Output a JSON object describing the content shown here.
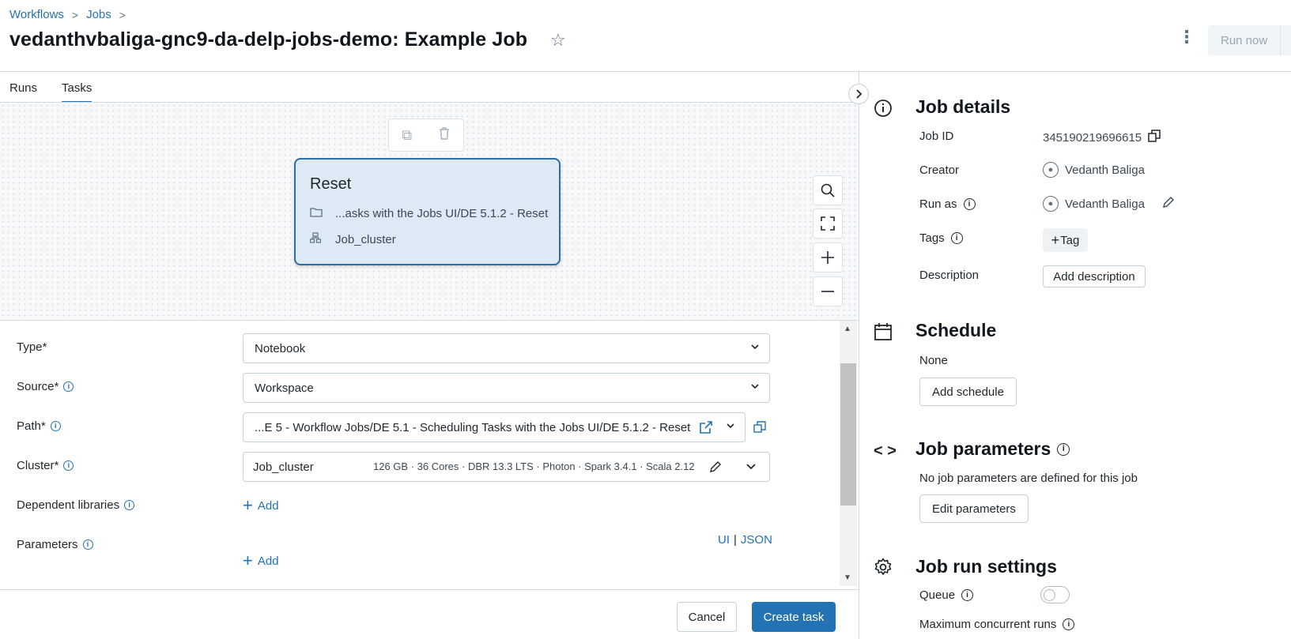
{
  "breadcrumb": {
    "items": [
      "Workflows",
      "Jobs"
    ],
    "separator": ">"
  },
  "title": "vedanthvbaliga-gnc9-da-delp-jobs-demo: Example Job",
  "header": {
    "run_now": "Run now",
    "kebab": "⋮",
    "star": "☆"
  },
  "tabs": [
    {
      "label": "Runs",
      "active": false
    },
    {
      "label": "Tasks",
      "active": true
    }
  ],
  "task_node": {
    "name": "Reset",
    "path": "...asks with the Jobs UI/DE 5.1.2 - Reset",
    "cluster": "Job_cluster"
  },
  "form": {
    "type": {
      "label": "Type*",
      "value": "Notebook"
    },
    "source": {
      "label": "Source*",
      "value": "Workspace"
    },
    "path": {
      "label": "Path*",
      "value": "...E 5 - Workflow Jobs/DE 5.1 - Scheduling Tasks with the Jobs UI/DE 5.1.2 - Reset"
    },
    "cluster": {
      "label": "Cluster*",
      "name": "Job_cluster",
      "details": "126 GB · 36 Cores · DBR 13.3 LTS · Photon · Spark 3.4.1 · Scala 2.12"
    },
    "dependent_libraries": {
      "label": "Dependent libraries",
      "add": "Add"
    },
    "parameters": {
      "label": "Parameters",
      "add": "Add",
      "ui": "UI",
      "sep": "|",
      "json": "JSON"
    }
  },
  "footer": {
    "cancel": "Cancel",
    "create": "Create task"
  },
  "job_details": {
    "title": "Job details",
    "job_id_label": "Job ID",
    "job_id": "345190219696615",
    "creator_label": "Creator",
    "creator": "Vedanth Baliga",
    "run_as_label": "Run as",
    "run_as": "Vedanth Baliga",
    "tags_label": "Tags",
    "tag_button": "Tag",
    "description_label": "Description",
    "add_description": "Add description"
  },
  "schedule": {
    "title": "Schedule",
    "value": "None",
    "add": "Add schedule"
  },
  "job_parameters": {
    "title": "Job parameters",
    "text": "No job parameters are defined for this job",
    "edit": "Edit parameters"
  },
  "job_run_settings": {
    "title": "Job run settings",
    "queue_label": "Queue",
    "max_runs_label": "Maximum concurrent runs"
  },
  "colors": {
    "accent": "#2272b4",
    "node_fill": "#dde9f4",
    "node_border": "#2b6fa6"
  }
}
